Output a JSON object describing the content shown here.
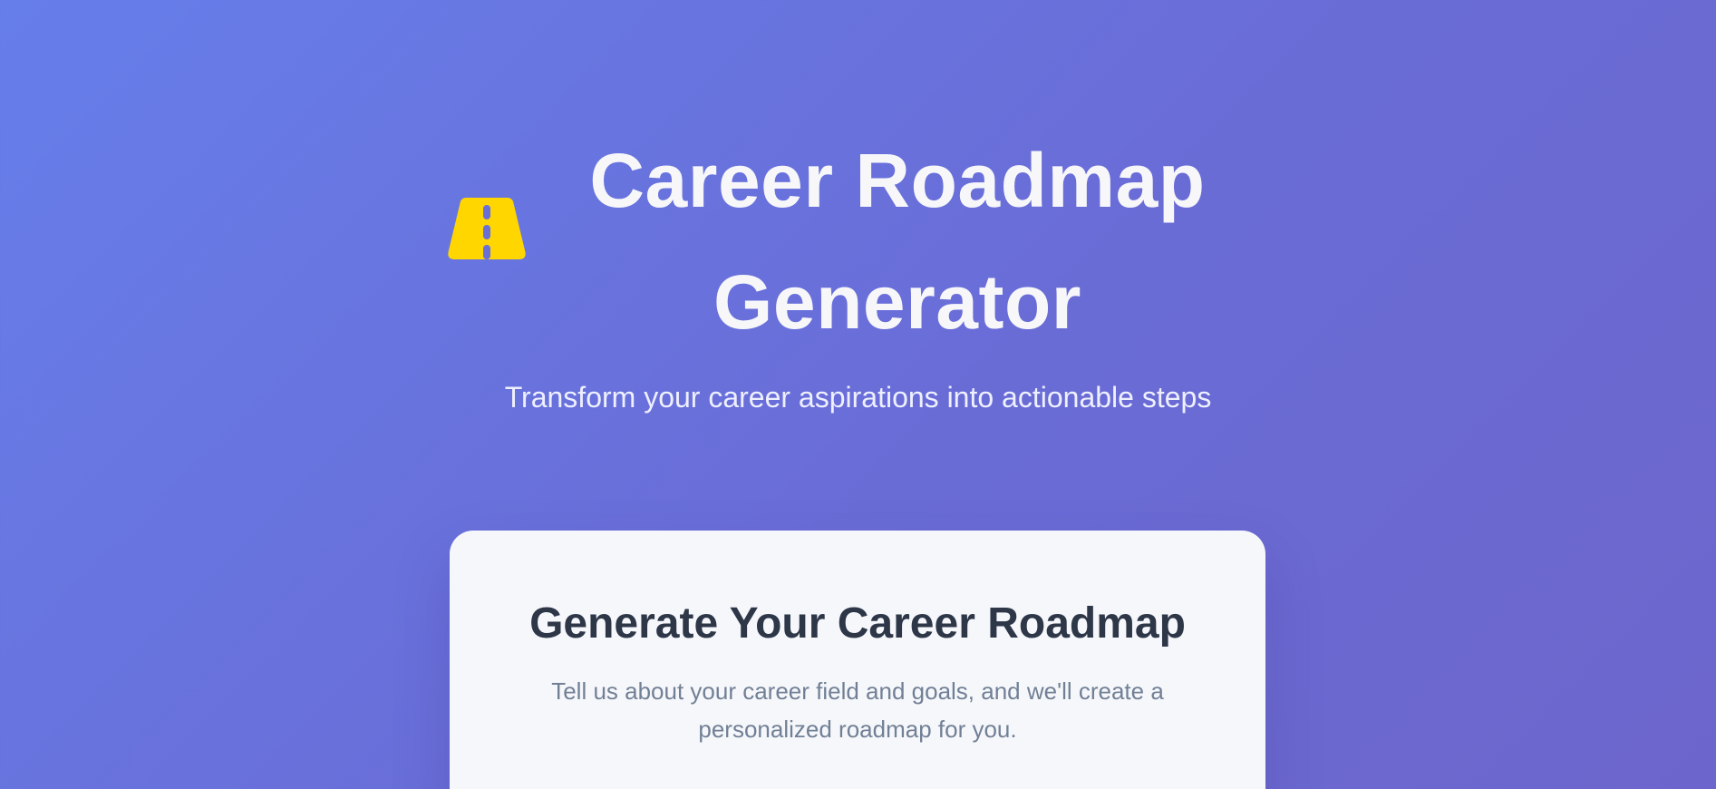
{
  "header": {
    "icon": "road-icon",
    "icon_color": "#ffd600",
    "title": "Career Roadmap Generator",
    "subtitle": "Transform your career aspirations into actionable steps"
  },
  "card": {
    "title": "Generate Your Career Roadmap",
    "description": "Tell us about your career field and goals, and we'll create a personalized roadmap for you."
  },
  "colors": {
    "background_start": "#667eea",
    "background_end": "#6c66cc",
    "title_text": "#f7f7fa",
    "card_background": "#f6f7fb",
    "card_title": "#2d3748",
    "card_text": "#718096"
  }
}
